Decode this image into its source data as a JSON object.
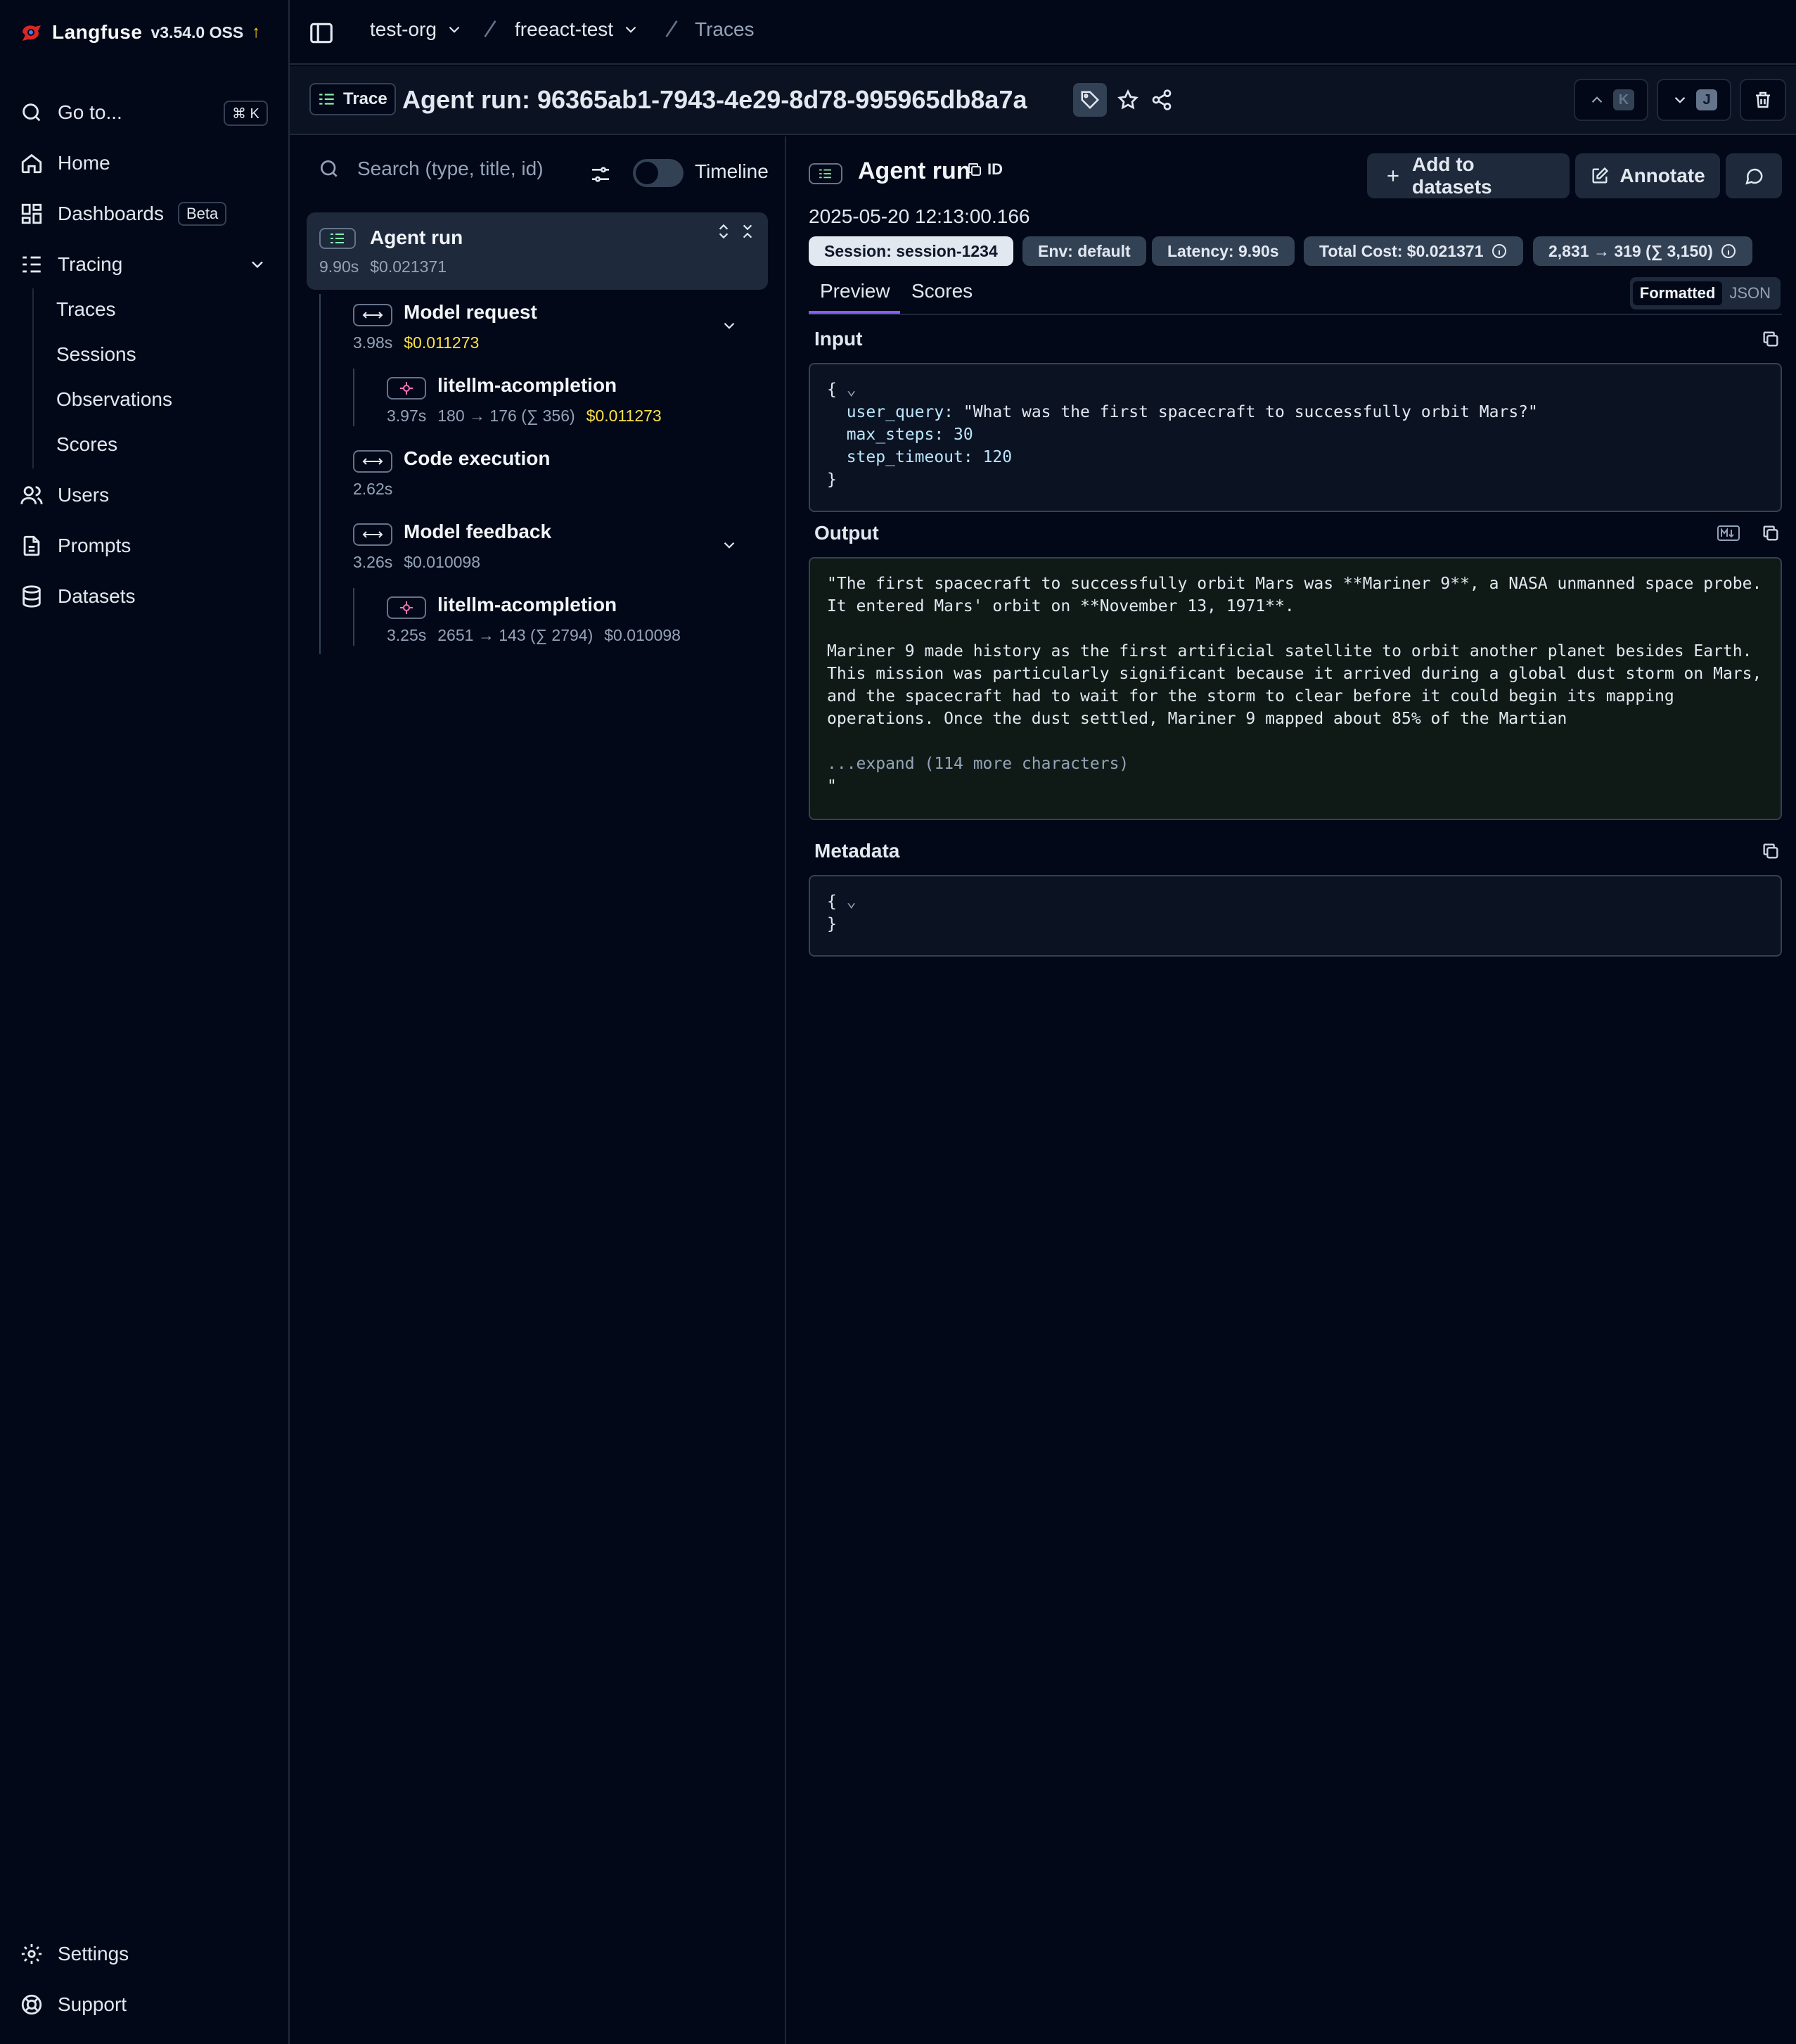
{
  "sidebar": {
    "brand": "Langfuse",
    "version": "v3.54.0 OSS",
    "update_arrow": "↑",
    "goto": {
      "label": "Go to...",
      "shortcut": "⌘ K"
    },
    "items": [
      {
        "label": "Home",
        "icon": "home-icon"
      },
      {
        "label": "Dashboards",
        "icon": "dashboard-icon",
        "badge": "Beta"
      },
      {
        "label": "Tracing",
        "icon": "tracing-icon"
      }
    ],
    "tracing_sub": [
      "Traces",
      "Sessions",
      "Observations",
      "Scores"
    ],
    "items_after": [
      {
        "label": "Users",
        "icon": "users-icon"
      },
      {
        "label": "Prompts",
        "icon": "prompts-icon"
      },
      {
        "label": "Datasets",
        "icon": "datasets-icon"
      }
    ],
    "footer": [
      {
        "label": "Settings",
        "icon": "settings-icon"
      },
      {
        "label": "Support",
        "icon": "support-icon"
      }
    ]
  },
  "topbar": {
    "org": "test-org",
    "project": "freeact-test",
    "page": "Traces"
  },
  "trace_header": {
    "tag": "Trace",
    "title": "Agent run: 96365ab1-7943-4e29-8d78-995965db8a7a",
    "prev_key": "K",
    "next_key": "J"
  },
  "tree": {
    "search_placeholder": "Search (type, title, id)",
    "timeline_label": "Timeline",
    "nodes": [
      {
        "name": "Agent run",
        "latency": "9.90s",
        "cost": "$0.021371"
      },
      {
        "name": "Model request",
        "latency": "3.98s",
        "cost": "$0.011273"
      },
      {
        "name": "litellm-acompletion",
        "latency": "3.97s",
        "tokens": "180 → 176 (∑ 356)",
        "cost": "$0.011273"
      },
      {
        "name": "Code execution",
        "latency": "2.62s"
      },
      {
        "name": "Model feedback",
        "latency": "3.26s",
        "cost": "$0.010098"
      },
      {
        "name": "litellm-acompletion",
        "latency": "3.25s",
        "tokens": "2651 → 143 (∑ 2794)",
        "cost": "$0.010098"
      }
    ]
  },
  "detail": {
    "title": "Agent run",
    "id_label": "ID",
    "add_to_datasets": "Add to datasets",
    "annotate": "Annotate",
    "timestamp": "2025-05-20 12:13:00.166",
    "pills": {
      "session": "Session: session-1234",
      "env": "Env: default",
      "latency": "Latency: 9.90s",
      "total_cost": "Total Cost: $0.021371",
      "tokens": "2,831 → 319 (∑ 3,150)"
    },
    "tabs": [
      "Preview",
      "Scores"
    ],
    "view_modes": [
      "Formatted",
      "JSON"
    ],
    "input_label": "Input",
    "input": {
      "open": "{",
      "user_query_key": "user_query:",
      "user_query": "\"What was the first spacecraft to successfully orbit Mars?\"",
      "max_steps_key": "max_steps:",
      "max_steps": "30",
      "step_timeout_key": "step_timeout:",
      "step_timeout": "120",
      "close": "}"
    },
    "output_label": "Output",
    "output_lines": [
      "\"The first spacecraft to successfully orbit Mars was **Mariner 9**, a NASA unmanned space probe.",
      "It entered Mars' orbit on **November 13, 1971**.",
      "",
      "Mariner 9 made history as the first artificial satellite to orbit another planet besides Earth.",
      "This mission was particularly significant because it arrived during a global dust storm on Mars,",
      "and the spacecraft had to wait for the storm to clear before it could begin its mapping",
      "operations. Once the dust settled, Mariner 9 mapped about 85% of the Martian"
    ],
    "output_expand": "...expand (114 more characters)",
    "output_close": "\"",
    "metadata_label": "Metadata",
    "metadata_open": "{",
    "metadata_close": "}"
  },
  "colors": {
    "background": "#020817",
    "accent": "#8b5cf6",
    "cost_highlight": "#fde047"
  }
}
